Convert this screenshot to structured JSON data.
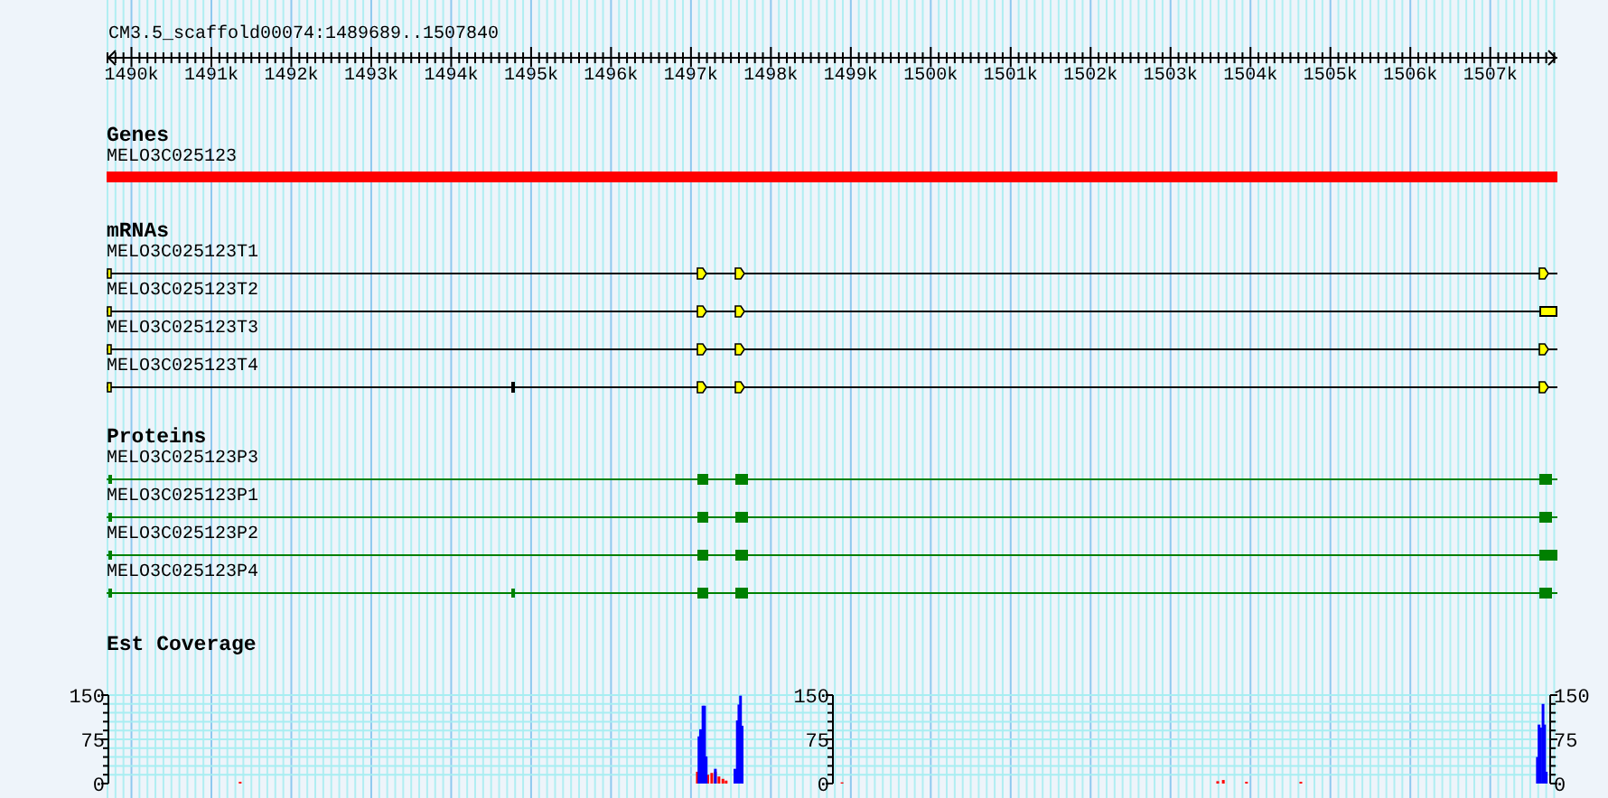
{
  "region": {
    "title": "CM3.5_scaffold00074:1489689..1507840"
  },
  "ruler": {
    "ticks": [
      "1490k",
      "1491k",
      "1492k",
      "1493k",
      "1494k",
      "1495k",
      "1496k",
      "1497k",
      "1498k",
      "1499k",
      "1500k",
      "1501k",
      "1502k",
      "1503k",
      "1504k",
      "1505k",
      "1506k",
      "1507k"
    ]
  },
  "tracks": [
    {
      "kind": "gene",
      "title": "Genes",
      "features": [
        {
          "label": "MELO3C025123"
        }
      ]
    },
    {
      "kind": "mrna",
      "title": "mRNAs",
      "features": [
        {
          "label": "MELO3C025123T1"
        },
        {
          "label": "MELO3C025123T2"
        },
        {
          "label": "MELO3C025123T3"
        },
        {
          "label": "MELO3C025123T4"
        }
      ]
    },
    {
      "kind": "protein",
      "title": "Proteins",
      "features": [
        {
          "label": "MELO3C025123P3"
        },
        {
          "label": "MELO3C025123P1"
        },
        {
          "label": "MELO3C025123P2"
        },
        {
          "label": "MELO3C025123P4"
        }
      ]
    },
    {
      "kind": "coverage",
      "title": "Est Coverage",
      "scales": [
        {
          "kind": "left",
          "labels": [
            "150",
            "75",
            "0"
          ]
        },
        {
          "kind": "left",
          "labels": [
            "150",
            "75",
            "0"
          ]
        },
        {
          "kind": "right",
          "labels": [
            "150",
            "75",
            "0"
          ]
        }
      ]
    }
  ]
}
